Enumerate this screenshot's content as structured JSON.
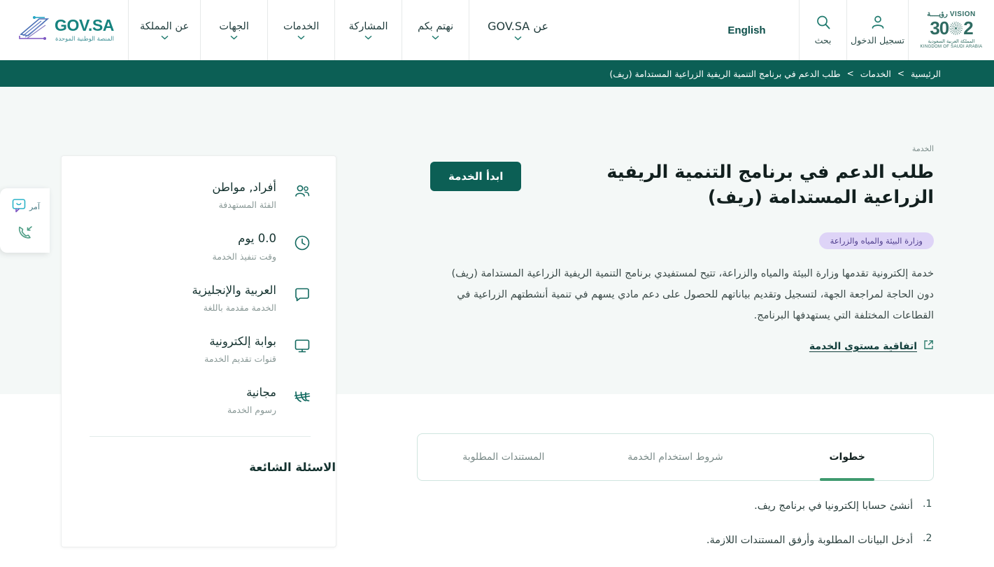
{
  "header": {
    "logo": {
      "main": "GOV.SA",
      "sub": "المنصة الوطنية الموحدة"
    },
    "nav": [
      {
        "label": "عن المملكة",
        "has_chevron": true
      },
      {
        "label": "الجهات",
        "has_chevron": true
      },
      {
        "label": "الخدمات",
        "has_chevron": true
      },
      {
        "label": "المشاركة",
        "has_chevron": true
      },
      {
        "label": "نهتم بكم",
        "has_chevron": true
      },
      {
        "label": "عن GOV.SA",
        "has_chevron": true
      }
    ],
    "language_toggle": "English",
    "search": {
      "label": "بحث",
      "icon": "search-icon"
    },
    "login": {
      "label": "تسجيل الدخول",
      "icon": "user-icon"
    },
    "vision": {
      "word": "VISION",
      "word_ar": "رؤيــــة",
      "year_left": "2",
      "year_right": "30",
      "kingdom_ar": "المملكة العربية السعودية",
      "kingdom_en": "KINGDOM OF SAUDI ARABIA"
    }
  },
  "breadcrumb": {
    "items": [
      {
        "label": "الرئيسية",
        "link": true
      },
      {
        "label": "الخدمات",
        "link": true
      },
      {
        "label": "طلب الدعم في برنامج التنمية الريفية الزراعية المستدامة (ريف)",
        "link": false
      }
    ],
    "separator": ">"
  },
  "hero": {
    "kicker": "الخدمة",
    "title": "طلب الدعم في برنامج التنمية الريفية الزراعية المستدامة (ريف)",
    "start_button": "ابدأ الخدمة",
    "agency_badge": "وزارة البيئة والمياه والزراعة",
    "agency_badge_bg": "#ded4f7",
    "agency_badge_color": "#4f3f8e",
    "description": "خدمة إلكترونية تقدمها وزارة البيئة والمياه والزراعة، تتيح لمستفيدي برنامج التنمية الريفية الزراعية المستدامة (ريف) دون الحاجة لمراجعة الجهة، لتسجيل وتقديم بياناتهم للحصول على دعم مادي يسهم في تنمية أنشطتهم الزراعية في القطاعات المختلفة التي يستهدفها البرنامج.",
    "sla_link": "اتفاقية مستوى الخدمة",
    "sla_icon": "external-link-icon",
    "accent_color": "#0c5f55",
    "background": "#f4f8f7"
  },
  "service_facts": [
    {
      "icon": "users-icon",
      "value": "أفراد, مواطن",
      "label": "الفئة المستهدفة"
    },
    {
      "icon": "clock-icon",
      "value": "0.0 يوم",
      "label": "وقت تنفيذ الخدمة"
    },
    {
      "icon": "chat-icon",
      "value": "العربية والإنجليزية",
      "label": "الخدمة مقدمة باللغة"
    },
    {
      "icon": "monitor-icon",
      "value": "بوابة إلكترونية",
      "label": "قنوات تقديم الخدمة"
    },
    {
      "icon": "riyal-icon",
      "value": "مجانية",
      "label": "رسوم الخدمة"
    }
  ],
  "faq_title": "الاسئلة الشائعة",
  "tabs": [
    {
      "label": "خطوات",
      "active": true
    },
    {
      "label": "شروط استخدام الخدمة",
      "active": false
    },
    {
      "label": "المستندات المطلوبة",
      "active": false
    }
  ],
  "tab_active_underline_color": "#3f9a6f",
  "steps": [
    {
      "num": "1.",
      "text": "أنشئ حسابا إلكترونيا في برنامج ريف."
    },
    {
      "num": "2.",
      "text": "أدخل البيانات المطلوبة وأرفق المستندات اللازمة."
    }
  ],
  "float_widget": {
    "chat": {
      "label": "آمر",
      "icon": "chat-bubble-icon"
    },
    "call": {
      "label": "",
      "icon": "phone-callback-icon"
    }
  }
}
